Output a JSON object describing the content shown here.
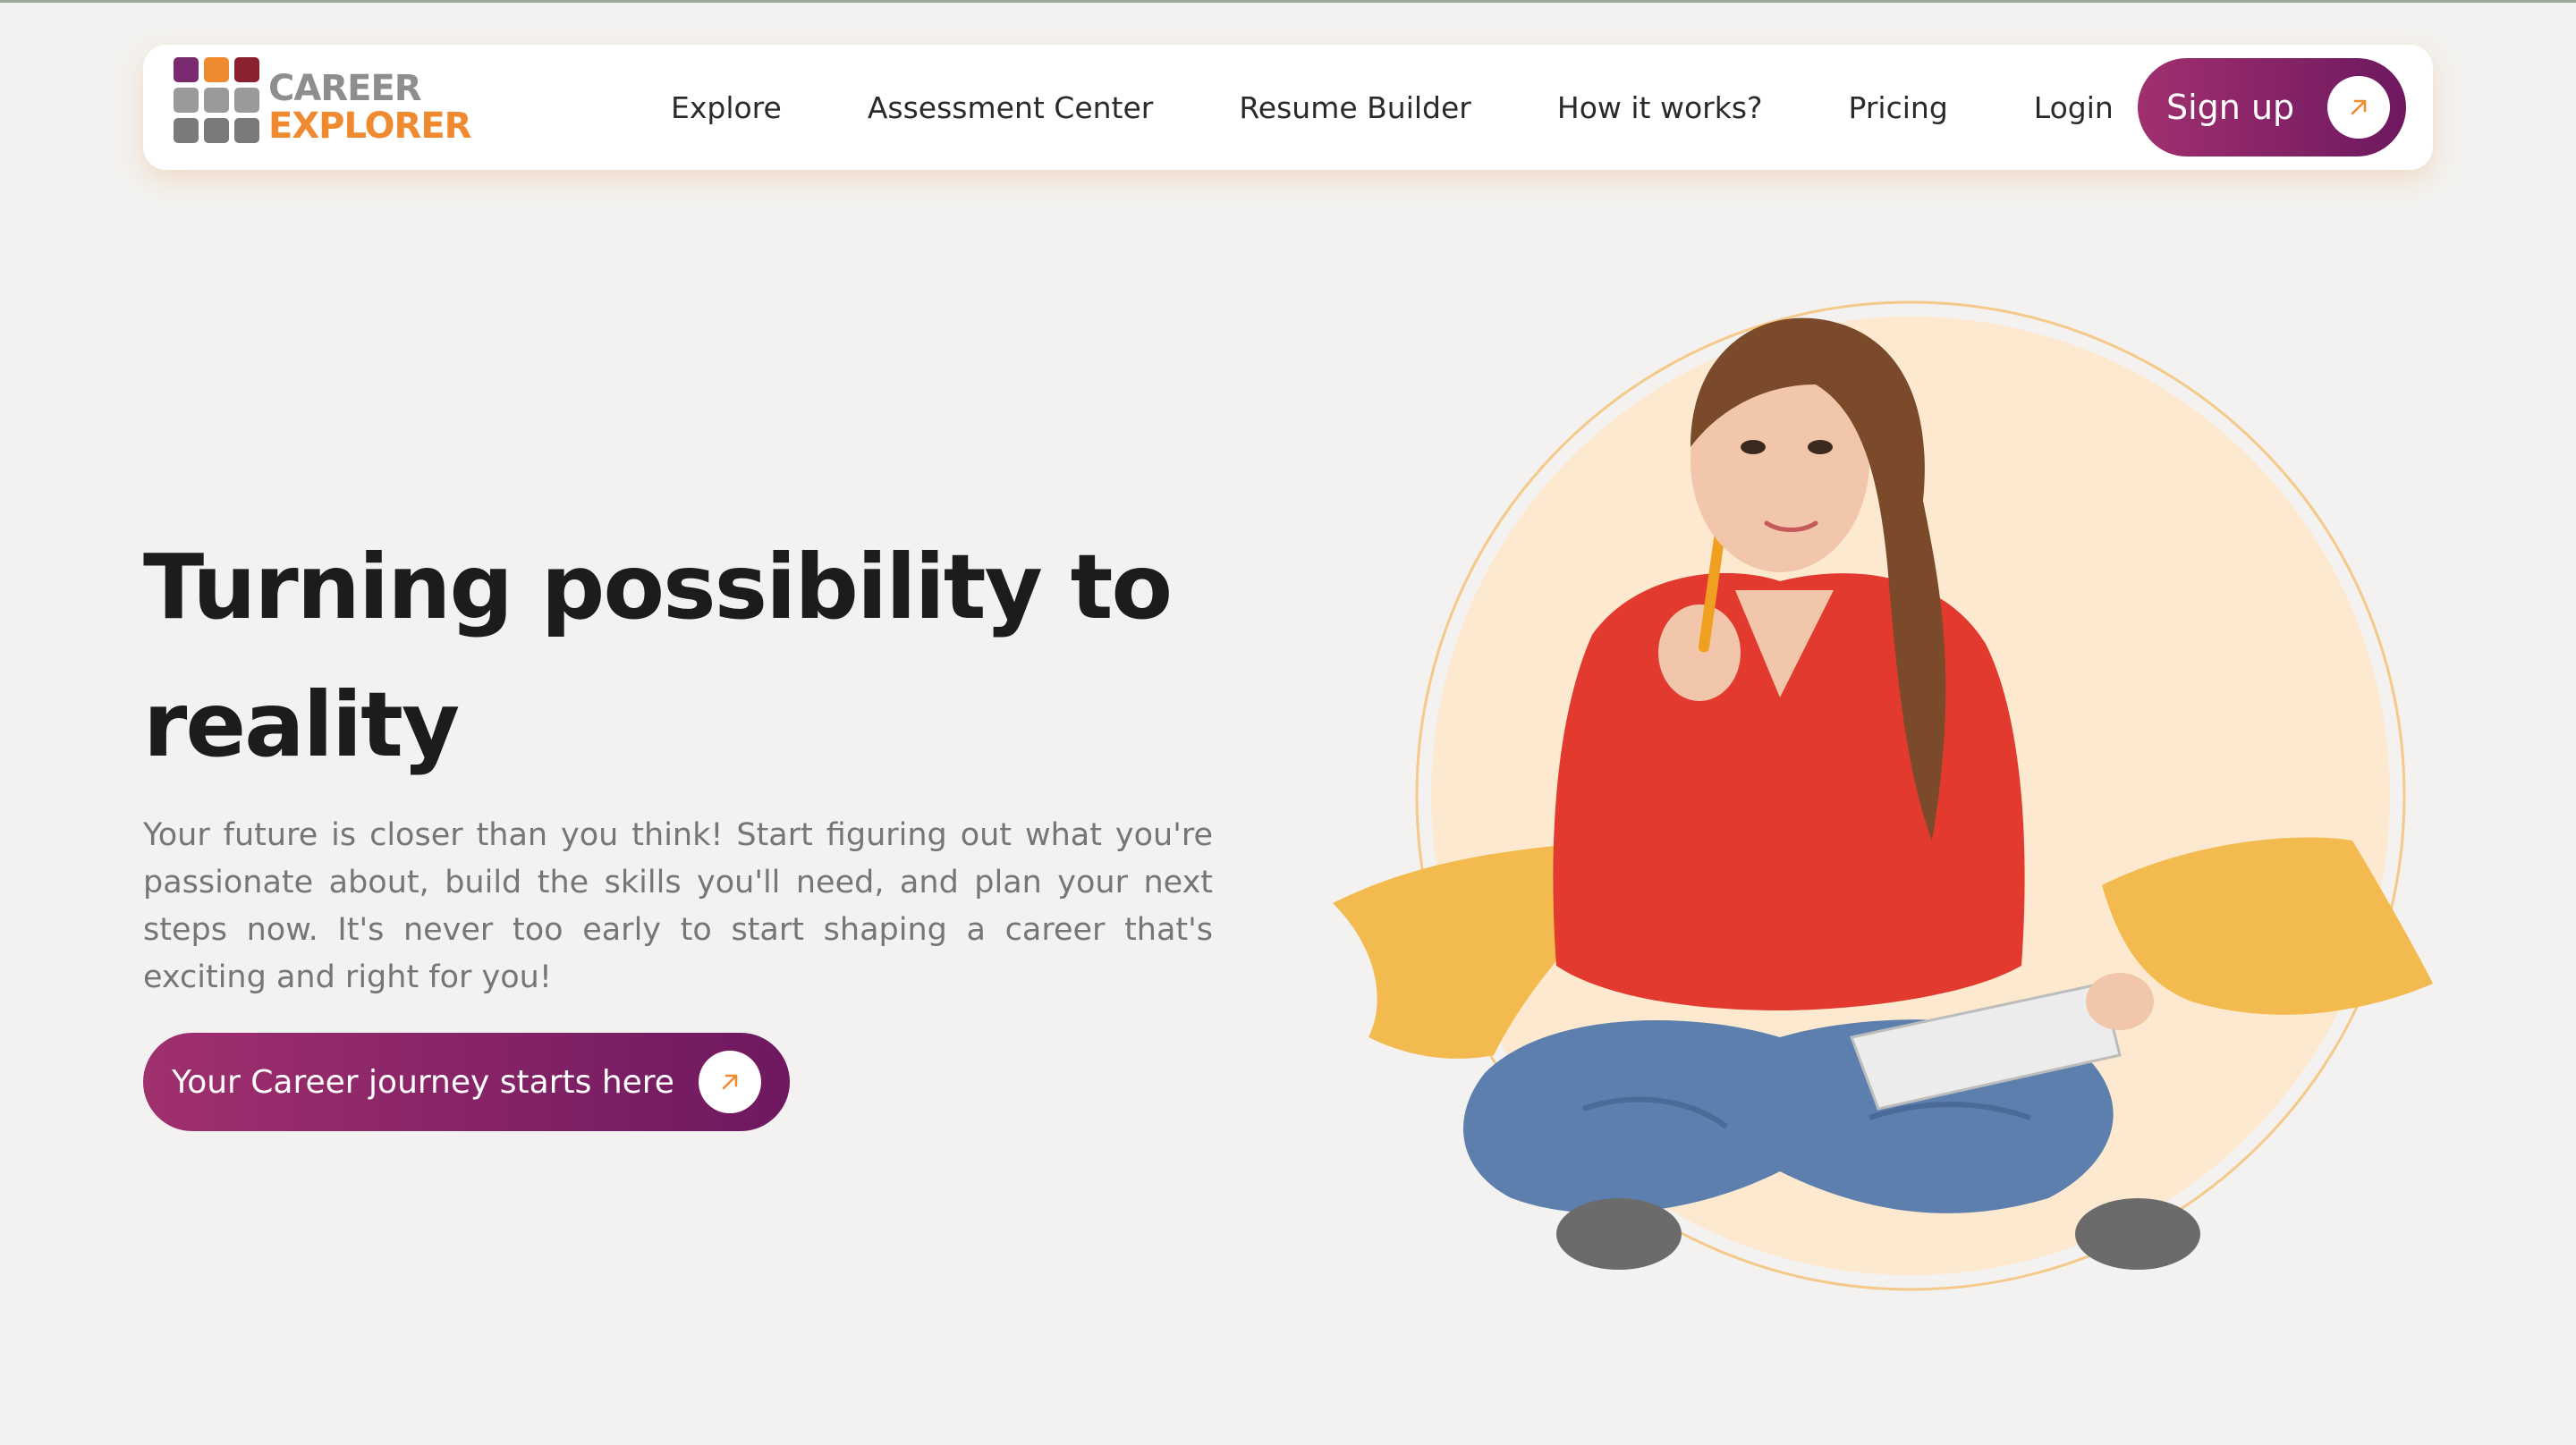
{
  "brand": {
    "logo_line1": "CAREER",
    "logo_line2": "EXPLORER",
    "colors": {
      "purple": "#7a2a6e",
      "orange": "#ef8a30",
      "dark_red": "#8a2030",
      "grey": "#8e8e8e"
    }
  },
  "nav": {
    "items": [
      {
        "label": "Explore"
      },
      {
        "label": "Assessment Center"
      },
      {
        "label": "Resume Builder"
      },
      {
        "label": "How it works?"
      },
      {
        "label": "Pricing"
      },
      {
        "label": "Login"
      }
    ],
    "signup_label": "Sign up",
    "signup_icon": "arrow-up-right-icon"
  },
  "hero": {
    "headline": "Turning possibility to reality",
    "body": "Your future is closer than you think! Start figuring out what you're passionate about, build the skills you'll need, and plan your next steps now. It's never too early to start shaping a career that's exciting and right for you!",
    "cta_label": "Your Career journey starts here",
    "cta_icon": "arrow-up-right-icon",
    "accent_gradient": [
      "#a0306e",
      "#6e1860"
    ],
    "circle_color": "#fde9cf",
    "brush_color": "#f3bb4f"
  }
}
